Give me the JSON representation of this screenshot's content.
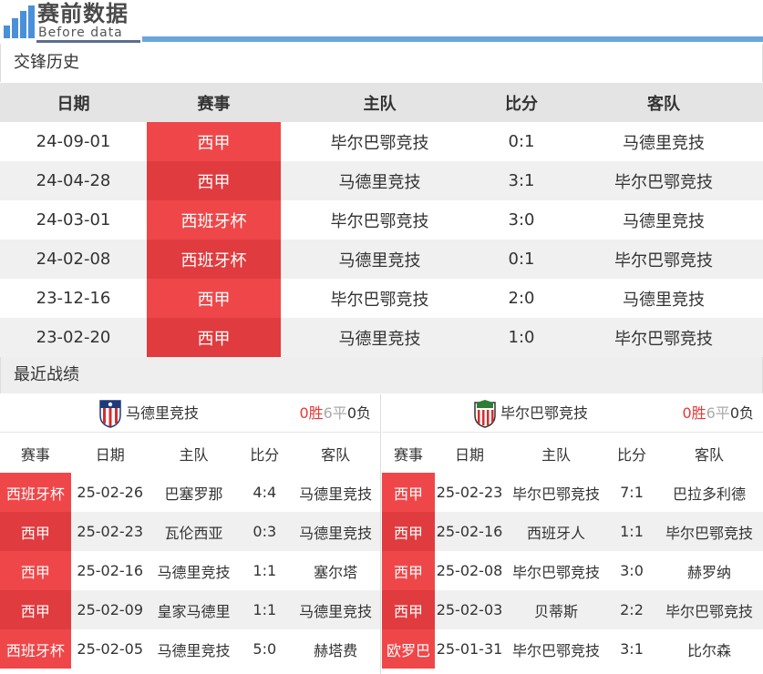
{
  "header": {
    "logo_title": "赛前数据",
    "logo_sub": "Before data",
    "accent": "#6aa7dc"
  },
  "h2h": {
    "title": "交锋历史",
    "columns": [
      "日期",
      "赛事",
      "主队",
      "比分",
      "客队"
    ],
    "rows": [
      {
        "date": "24-09-01",
        "comp": "西甲",
        "home": "毕尔巴鄂竞技",
        "score": "0:1",
        "away": "马德里竞技"
      },
      {
        "date": "24-04-28",
        "comp": "西甲",
        "home": "马德里竞技",
        "score": "3:1",
        "away": "毕尔巴鄂竞技"
      },
      {
        "date": "24-03-01",
        "comp": "西班牙杯",
        "home": "毕尔巴鄂竞技",
        "score": "3:0",
        "away": "马德里竞技"
      },
      {
        "date": "24-02-08",
        "comp": "西班牙杯",
        "home": "马德里竞技",
        "score": "0:1",
        "away": "毕尔巴鄂竞技"
      },
      {
        "date": "23-12-16",
        "comp": "西甲",
        "home": "毕尔巴鄂竞技",
        "score": "2:0",
        "away": "马德里竞技"
      },
      {
        "date": "23-02-20",
        "comp": "西甲",
        "home": "马德里竞技",
        "score": "1:0",
        "away": "毕尔巴鄂竞技"
      }
    ]
  },
  "recent": {
    "title": "最近战绩",
    "columns": [
      "赛事",
      "日期",
      "主队",
      "比分",
      "客队"
    ],
    "left": {
      "team": "马德里竞技",
      "crest_icon": "atletico-madrid-crest-icon",
      "wins": "0胜",
      "draws": "6平",
      "losses": "0负",
      "rows": [
        {
          "comp": "西班牙杯",
          "date": "25-02-26",
          "home": "巴塞罗那",
          "score": "4:4",
          "away": "马德里竞技"
        },
        {
          "comp": "西甲",
          "date": "25-02-23",
          "home": "瓦伦西亚",
          "score": "0:3",
          "away": "马德里竞技"
        },
        {
          "comp": "西甲",
          "date": "25-02-16",
          "home": "马德里竞技",
          "score": "1:1",
          "away": "塞尔塔"
        },
        {
          "comp": "西甲",
          "date": "25-02-09",
          "home": "皇家马德里",
          "score": "1:1",
          "away": "马德里竞技"
        },
        {
          "comp": "西班牙杯",
          "date": "25-02-05",
          "home": "马德里竞技",
          "score": "5:0",
          "away": "赫塔费"
        }
      ]
    },
    "right": {
      "team": "毕尔巴鄂竞技",
      "crest_icon": "athletic-bilbao-crest-icon",
      "wins": "0胜",
      "draws": "6平",
      "losses": "0负",
      "rows": [
        {
          "comp": "西甲",
          "date": "25-02-23",
          "home": "毕尔巴鄂竞技",
          "score": "7:1",
          "away": "巴拉多利德"
        },
        {
          "comp": "西甲",
          "date": "25-02-16",
          "home": "西班牙人",
          "score": "1:1",
          "away": "毕尔巴鄂竞技"
        },
        {
          "comp": "西甲",
          "date": "25-02-08",
          "home": "毕尔巴鄂竞技",
          "score": "3:0",
          "away": "赫罗纳"
        },
        {
          "comp": "西甲",
          "date": "25-02-03",
          "home": "贝蒂斯",
          "score": "2:2",
          "away": "毕尔巴鄂竞技"
        },
        {
          "comp": "欧罗巴",
          "date": "25-01-31",
          "home": "毕尔巴鄂竞技",
          "score": "3:1",
          "away": "比尔森"
        }
      ]
    }
  },
  "colors": {
    "comp_red": "#ef4749",
    "comp_red_dark": "#e03b3e",
    "win_red": "#e53935",
    "draw_grey": "#aaaaaa"
  }
}
